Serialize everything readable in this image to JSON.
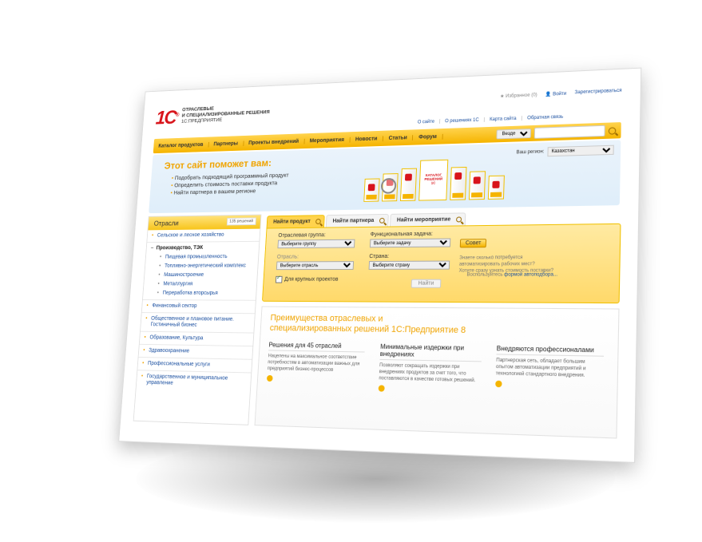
{
  "logo": {
    "mark": "1С",
    "line1": "ОТРАСЛЕВЫЕ",
    "line2": "И СПЕЦИАЛИЗИРОВАННЫЕ РЕШЕНИЯ",
    "line3": "1С:ПРЕДПРИЯТИЕ"
  },
  "top": {
    "favorites": "Избранное (0)",
    "login": "Войти",
    "register": "Зарегистрироваться"
  },
  "links": [
    "О сайте",
    "О решениях 1С",
    "Карта сайта",
    "Обратная связь"
  ],
  "nav": [
    "Каталог продуктов",
    "Партнеры",
    "Проекты внедрений",
    "Мероприятия",
    "Новости",
    "Статьи",
    "Форум"
  ],
  "search": {
    "scope": "Везде"
  },
  "promo": {
    "title": "Этот сайт поможет вам:",
    "items": [
      "Подобрать подходящий программный продукт",
      "Определить стоимость поставки продукта",
      "Найти партнера в вашем регионе"
    ],
    "region_label": "Ваш регион:",
    "region_value": "Казахстан",
    "box_label": "КАТАЛОГ РЕШЕНИЙ 1С"
  },
  "sidebar": {
    "title": "Отрасли",
    "count": "135 решений",
    "items": [
      "Сельское и лесное хозяйство",
      "Производство, ТЭК",
      "Пищевая промышленность",
      "Топливно-энергетический комплекс",
      "Машиностроение",
      "Металлургия",
      "Переработка вторсырья",
      "Финансовый сектор",
      "Общественное и плановое питание. Гостиничный бизнес",
      "Образование, Культура",
      "Здравоохранение",
      "Профессиональные услуги",
      "Государственное и муниципальное управление"
    ]
  },
  "tabs": [
    "Найти продукт",
    "Найти партнера",
    "Найти мероприятие"
  ],
  "form": {
    "group_label": "Отраслевая группа:",
    "group_placeholder": "Выберите группу",
    "task_label": "Функциональная задача:",
    "task_placeholder": "Выберите задачу",
    "industry_label": "Отрасль:",
    "industry_placeholder": "Выберите отрасль",
    "country_label": "Страна:",
    "country_placeholder": "Выберите страну",
    "advice_button": "Совет",
    "hint_line1": "Знаете сколько потребуется",
    "hint_line2": "автоматизировать рабочих мест?",
    "hint_line3": "Хотите сразу узнать стоимость поставки?",
    "hint_link_prefix": "Воспользуйтесь ",
    "hint_link": "формой автоподбора...",
    "large_projects": "Для крупных проектов",
    "find_button": "Найти"
  },
  "advantages": {
    "title": "Преимущества отраслевых и специализированных решений 1С:Предприятие 8",
    "cols": [
      {
        "head": "Решения для 45 отраслей",
        "text": "Нацелены на максимальное соответствие потребностям в автоматизации важных для предприятий бизнес-процессов"
      },
      {
        "head": "Минимальные издержки при внедрениях",
        "text": "Позволяют сокращать издержки при внедрениях продуктов за счет того, что поставляются в качестве готовых решений."
      },
      {
        "head": "Внедряются профессионалами",
        "text": "Партнерская сеть, обладает большим опытом автоматизации предприятий и технологией стандартного внедрения."
      }
    ]
  }
}
